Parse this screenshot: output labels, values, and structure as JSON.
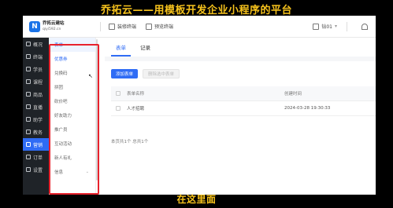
{
  "overlay": {
    "top_title": "乔拓云——用模板开发企业小程序的平台",
    "bottom_caption": "在这里面"
  },
  "header": {
    "logo_glyph": "N",
    "logo_name": "乔拓云建站",
    "logo_sub": "qiyi592.cn",
    "decorate_label": "装修终端",
    "preview_label": "预览终端",
    "account_label": "钻01",
    "account_chevron": "▾",
    "account_icon": "building-icon",
    "support_icon": "headset-icon"
  },
  "sidebar": {
    "items": [
      {
        "label": "概况",
        "icon": "overview-icon"
      },
      {
        "label": "终端",
        "icon": "terminal-icon"
      },
      {
        "label": "学员",
        "icon": "student-icon"
      },
      {
        "label": "课程",
        "icon": "course-icon"
      },
      {
        "label": "商品",
        "icon": "goods-icon"
      },
      {
        "label": "直播",
        "icon": "live-icon"
      },
      {
        "label": "助学",
        "icon": "study-icon"
      },
      {
        "label": "教务",
        "icon": "academic-icon"
      },
      {
        "label": "营销",
        "icon": "marketing-icon"
      },
      {
        "label": "订单",
        "icon": "order-icon"
      },
      {
        "label": "设置",
        "icon": "settings-icon"
      }
    ]
  },
  "submenu": {
    "items": [
      {
        "label": "表单"
      },
      {
        "label": "优惠券"
      },
      {
        "label": "兑换码"
      },
      {
        "label": "拼团"
      },
      {
        "label": "砍价吧"
      },
      {
        "label": "好友助力"
      },
      {
        "label": "推广员"
      },
      {
        "label": "互动活动"
      },
      {
        "label": "新人有礼"
      },
      {
        "label": "信息"
      }
    ],
    "chevron": "⌄",
    "collapse_glyph": "‹"
  },
  "main": {
    "tabs": [
      {
        "label": "表单"
      },
      {
        "label": "记录"
      }
    ],
    "add_button": "添加表单",
    "delete_button": "删除选中表单",
    "table": {
      "columns": [
        "表单名称",
        "创建时间"
      ],
      "rows": [
        {
          "name": "人才招聘",
          "created": "2024-03-28 19:30:33"
        }
      ]
    },
    "footer": "本页共1个 总共1个"
  },
  "colors": {
    "accent": "#2f6cf5",
    "sidebar_bg": "#1f2328",
    "highlight_box": "#e8222c",
    "banner_text": "#f6c21c"
  }
}
